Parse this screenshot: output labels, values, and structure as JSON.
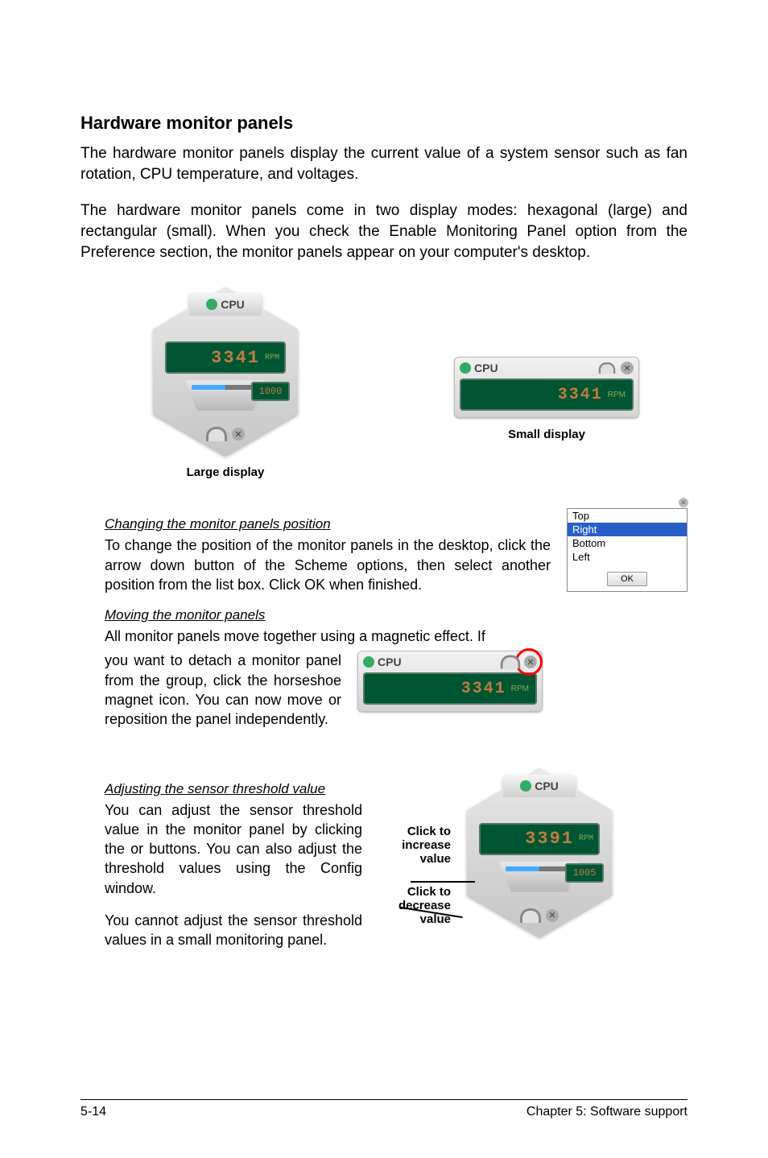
{
  "title": "Hardware monitor panels",
  "para1": "The hardware monitor panels display the current value of a system sensor such as fan rotation, CPU temperature, and voltages.",
  "para2": "The hardware monitor panels come in two display modes: hexagonal (large) and rectangular (small). When you check the Enable Monitoring Panel option from the Preference section, the monitor panels appear on your computer's desktop.",
  "large": {
    "label": "CPU",
    "value": "3341",
    "unit": "RPM",
    "threshold": "1000",
    "caption": "Large display"
  },
  "small": {
    "label": "CPU",
    "value": "3341",
    "unit": "RPM",
    "caption": "Small display"
  },
  "changing": {
    "heading": "Changing the monitor panels position",
    "text": "To change the position of the monitor panels in the desktop, click the arrow down button of the Scheme options, then select another position from the list box. Click OK when finished."
  },
  "posbox": {
    "items": [
      "Top",
      "Right",
      "Bottom",
      "Left"
    ],
    "selected": "Right",
    "ok": "OK"
  },
  "moving": {
    "heading": "Moving the monitor panels",
    "text_full": "All monitor panels move together using a magnetic effect. If you want to detach a monitor panel from the group, click the horseshoe magnet icon. You can now move or reposition the panel independently.",
    "text_line1": "All monitor panels move together using a magnetic effect. If",
    "text_rest": "you want to detach a monitor panel from the group, click the horseshoe magnet icon. You can now move or reposition the panel independently.",
    "panel_label": "CPU",
    "panel_value": "3341",
    "panel_unit": "RPM"
  },
  "adjusting": {
    "heading": "Adjusting the sensor threshold value",
    "text1": "You can adjust the sensor threshold value in the monitor panel by clicking the  or  buttons. You can also adjust the threshold values using the Config window.",
    "text2": "You cannot adjust the sensor threshold values in a small monitoring panel.",
    "inc_label": "Click to increase value",
    "dec_label": "Click to decrease value",
    "panel_label": "CPU",
    "panel_value": "3391",
    "panel_unit": "RPM",
    "panel_thresh": "1005"
  },
  "footer": {
    "left": "5-14",
    "right": "Chapter 5: Software support"
  }
}
